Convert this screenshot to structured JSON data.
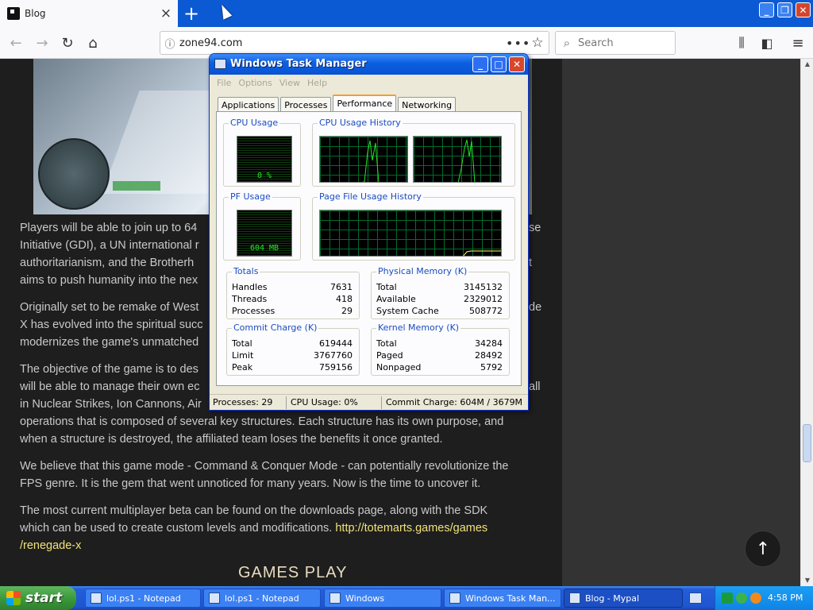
{
  "browser": {
    "tab_title": "Blog",
    "tab_close": "×",
    "new_tab": "+",
    "url": "zone94.com",
    "search_placeholder": "Search",
    "page_actions": "•••"
  },
  "article": {
    "para1": "Players will be able to join up to 64\nInitiative (GDI), a UN international r\nauthoritarianism, and the Brotherh\naims to push humanity into the nex",
    "para2": "Originally set to be remake of West\nX has evolved into the spiritual succ\nmodernizes the game's unmatched",
    "para3": "The objective of the game is to des\nwill be able to manage their own ec\nin Nuclear Strikes, Ion Cannons, Air\noperations that is composed of several key structures. Each structure has its own purpose, and\nwhen a structure is destroyed, the affiliated team loses the benefits it once granted.",
    "para4": "We believe that this game mode - Command & Conquer Mode - can potentially revolutionize the\nFPS genre. It is the gem that went unnoticed for many years. Now is the time to uncover it.",
    "para5_text": "The most current multiplayer beta can be found on the downloads page, along with the SDK\nwhich can be used to create custom levels and modifications. ",
    "para5_link": "http://totemarts.games/games\n/renegade-x",
    "right_fragments": [
      "se",
      "t",
      "de",
      "all"
    ],
    "games_play_heading": "GAMES PLAY"
  },
  "task_manager": {
    "title": "Windows Task Manager",
    "menu": [
      "File",
      "Options",
      "View",
      "Help"
    ],
    "tabs": [
      "Applications",
      "Processes",
      "Performance",
      "Networking"
    ],
    "active_tab": "Performance",
    "cpu_usage": {
      "label": "CPU Usage",
      "value": "0 %"
    },
    "cpu_history": {
      "label": "CPU Usage History"
    },
    "pf_usage": {
      "label": "PF Usage",
      "value": "604 MB"
    },
    "pf_history": {
      "label": "Page File Usage History"
    },
    "totals": {
      "label": "Totals",
      "rows": [
        {
          "k": "Handles",
          "v": "7631"
        },
        {
          "k": "Threads",
          "v": "418"
        },
        {
          "k": "Processes",
          "v": "29"
        }
      ]
    },
    "physical_memory": {
      "label": "Physical Memory (K)",
      "rows": [
        {
          "k": "Total",
          "v": "3145132"
        },
        {
          "k": "Available",
          "v": "2329012"
        },
        {
          "k": "System Cache",
          "v": "508772"
        }
      ]
    },
    "commit_charge": {
      "label": "Commit Charge (K)",
      "rows": [
        {
          "k": "Total",
          "v": "619444"
        },
        {
          "k": "Limit",
          "v": "3767760"
        },
        {
          "k": "Peak",
          "v": "759156"
        }
      ]
    },
    "kernel_memory": {
      "label": "Kernel Memory (K)",
      "rows": [
        {
          "k": "Total",
          "v": "34284"
        },
        {
          "k": "Paged",
          "v": "28492"
        },
        {
          "k": "Nonpaged",
          "v": "5792"
        }
      ]
    },
    "status": {
      "processes": "Processes: 29",
      "cpu": "CPU Usage: 0%",
      "commit": "Commit Charge: 604M / 3679M"
    }
  },
  "taskbar": {
    "start_label": "start",
    "tasks": [
      {
        "label": "lol.ps1 - Notepad",
        "active": false
      },
      {
        "label": "lol.ps1 - Notepad",
        "active": false
      },
      {
        "label": "Windows",
        "active": false
      },
      {
        "label": "Windows Task Man...",
        "active": false
      },
      {
        "label": "Blog - Mypal",
        "active": true
      }
    ],
    "clock": "4:58 PM"
  },
  "colors": {
    "xp_blue": "#245edb",
    "monitor_green": "#22e622",
    "link_yellow": "#f0e27a"
  }
}
